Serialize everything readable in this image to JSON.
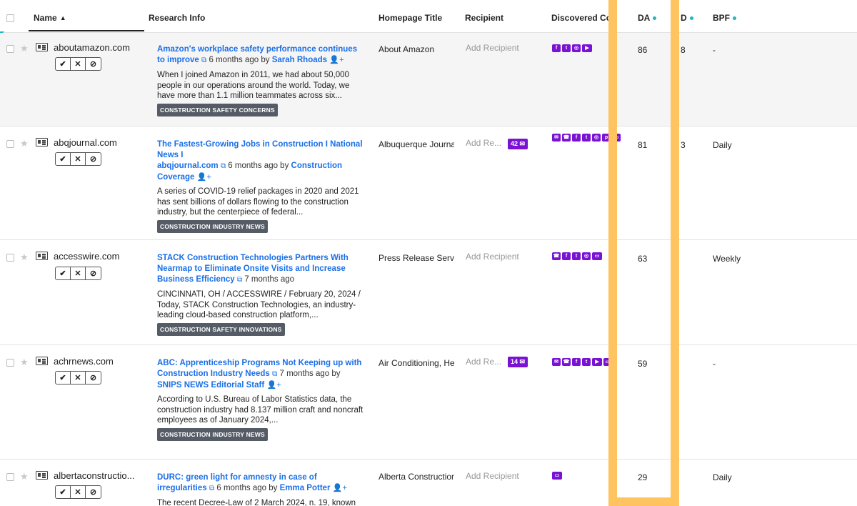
{
  "columns": {
    "name": "Name",
    "research_info": "Research Info",
    "homepage_title": "Homepage Title",
    "recipient": "Recipient",
    "discovered_contacts": "Discovered Co...",
    "da": "DA",
    "col_d": "D",
    "bpf": "BPF"
  },
  "rows": [
    {
      "domain": "aboutamazon.com",
      "title": "Amazon's workplace safety performance continues to improve",
      "meta": " 6 months ago by ",
      "author": "Sarah Rhoads",
      "snippet": "When I joined Amazon in 2011, we had about 50,000 people in our operations around the world. Today, we have more than 1.1 million teammates across six...",
      "tag": "CONSTRUCTION SAFETY CONCERNS",
      "homepage": "About Amazon",
      "recipient": "Add Recipient",
      "count": "",
      "contacts": [
        "facebook-icon",
        "twitter-icon",
        "instagram-icon",
        "youtube-icon"
      ],
      "da": "86",
      "col_d": "8",
      "bpf": "-"
    },
    {
      "domain": "abqjournal.com",
      "title": "The Fastest-Growing Jobs in Construction I National News I",
      "title_source": "abqjournal.com",
      "meta": " 6 months ago by ",
      "author": "Construction Coverage",
      "snippet": "A series of COVID-19 relief packages in 2020 and 2021 has sent billions of dollars flowing to the construction industry, but the centerpiece of federal...",
      "tag": "CONSTRUCTION INDUSTRY NEWS",
      "homepage": "Albuquerque Journal",
      "recipient": "Add Re...",
      "count": "42",
      "contacts": [
        "email-icon",
        "phone-icon",
        "facebook-icon",
        "twitter-icon",
        "instagram-icon",
        "pinterest-icon",
        "browser-icon"
      ],
      "da": "81",
      "col_d": "3",
      "bpf": "Daily"
    },
    {
      "domain": "accesswire.com",
      "title": "STACK Construction Technologies Partners With Nearmap to Eliminate Onsite Visits and Increase Business Efficiency",
      "meta": " 7 months ago",
      "author": "",
      "snippet": "CINCINNATI, OH / ACCESSWIRE / February 20, 2024 / Today, STACK Construction Technologies, an industry-leading cloud-based construction platform,...",
      "tag": "CONSTRUCTION SAFETY INNOVATIONS",
      "homepage": "Press Release Servic",
      "recipient": "Add Recipient",
      "count": "",
      "contacts": [
        "phone-icon",
        "facebook-icon",
        "twitter-icon",
        "instagram-icon",
        "browser-icon"
      ],
      "da": "63",
      "col_d": "",
      "bpf": "Weekly"
    },
    {
      "domain": "achrnews.com",
      "title": "ABC: Apprenticeship Programs Not Keeping up with Construction Industry Needs",
      "meta": " 7 months ago by ",
      "author": "SNIPS NEWS Editorial Staff",
      "snippet": "According to U.S. Bureau of Labor Statistics data, the construction industry had 8.137 million craft and noncraft employees as of January 2024,...",
      "tag": "CONSTRUCTION INDUSTRY NEWS",
      "homepage": "Air Conditioning, Hea",
      "recipient": "Add Re...",
      "count": "14",
      "contacts": [
        "email-icon",
        "phone-icon",
        "facebook-icon",
        "twitter-icon",
        "youtube-icon",
        "browser-icon"
      ],
      "da": "59",
      "col_d": "",
      "bpf": "-"
    },
    {
      "domain": "albertaconstructio...",
      "title": "DURC: green light for amnesty in case of irregularities",
      "meta": " 6 months ago by ",
      "author": "Emma Potter",
      "snippet": "The recent Decree-Law of 2 March 2024, n. 19, known",
      "tag": "",
      "homepage": "Alberta Construction I",
      "recipient": "Add Recipient",
      "count": "",
      "contacts": [
        "browser-icon"
      ],
      "da": "29",
      "col_d": "",
      "bpf": "Daily"
    }
  ],
  "colors": {
    "link": "#1a6fe8",
    "contact_icon": "#7a12d4",
    "tag_bg": "#555c66",
    "highlight": "#ffc460",
    "sort_dot": "#1fb6c1"
  }
}
